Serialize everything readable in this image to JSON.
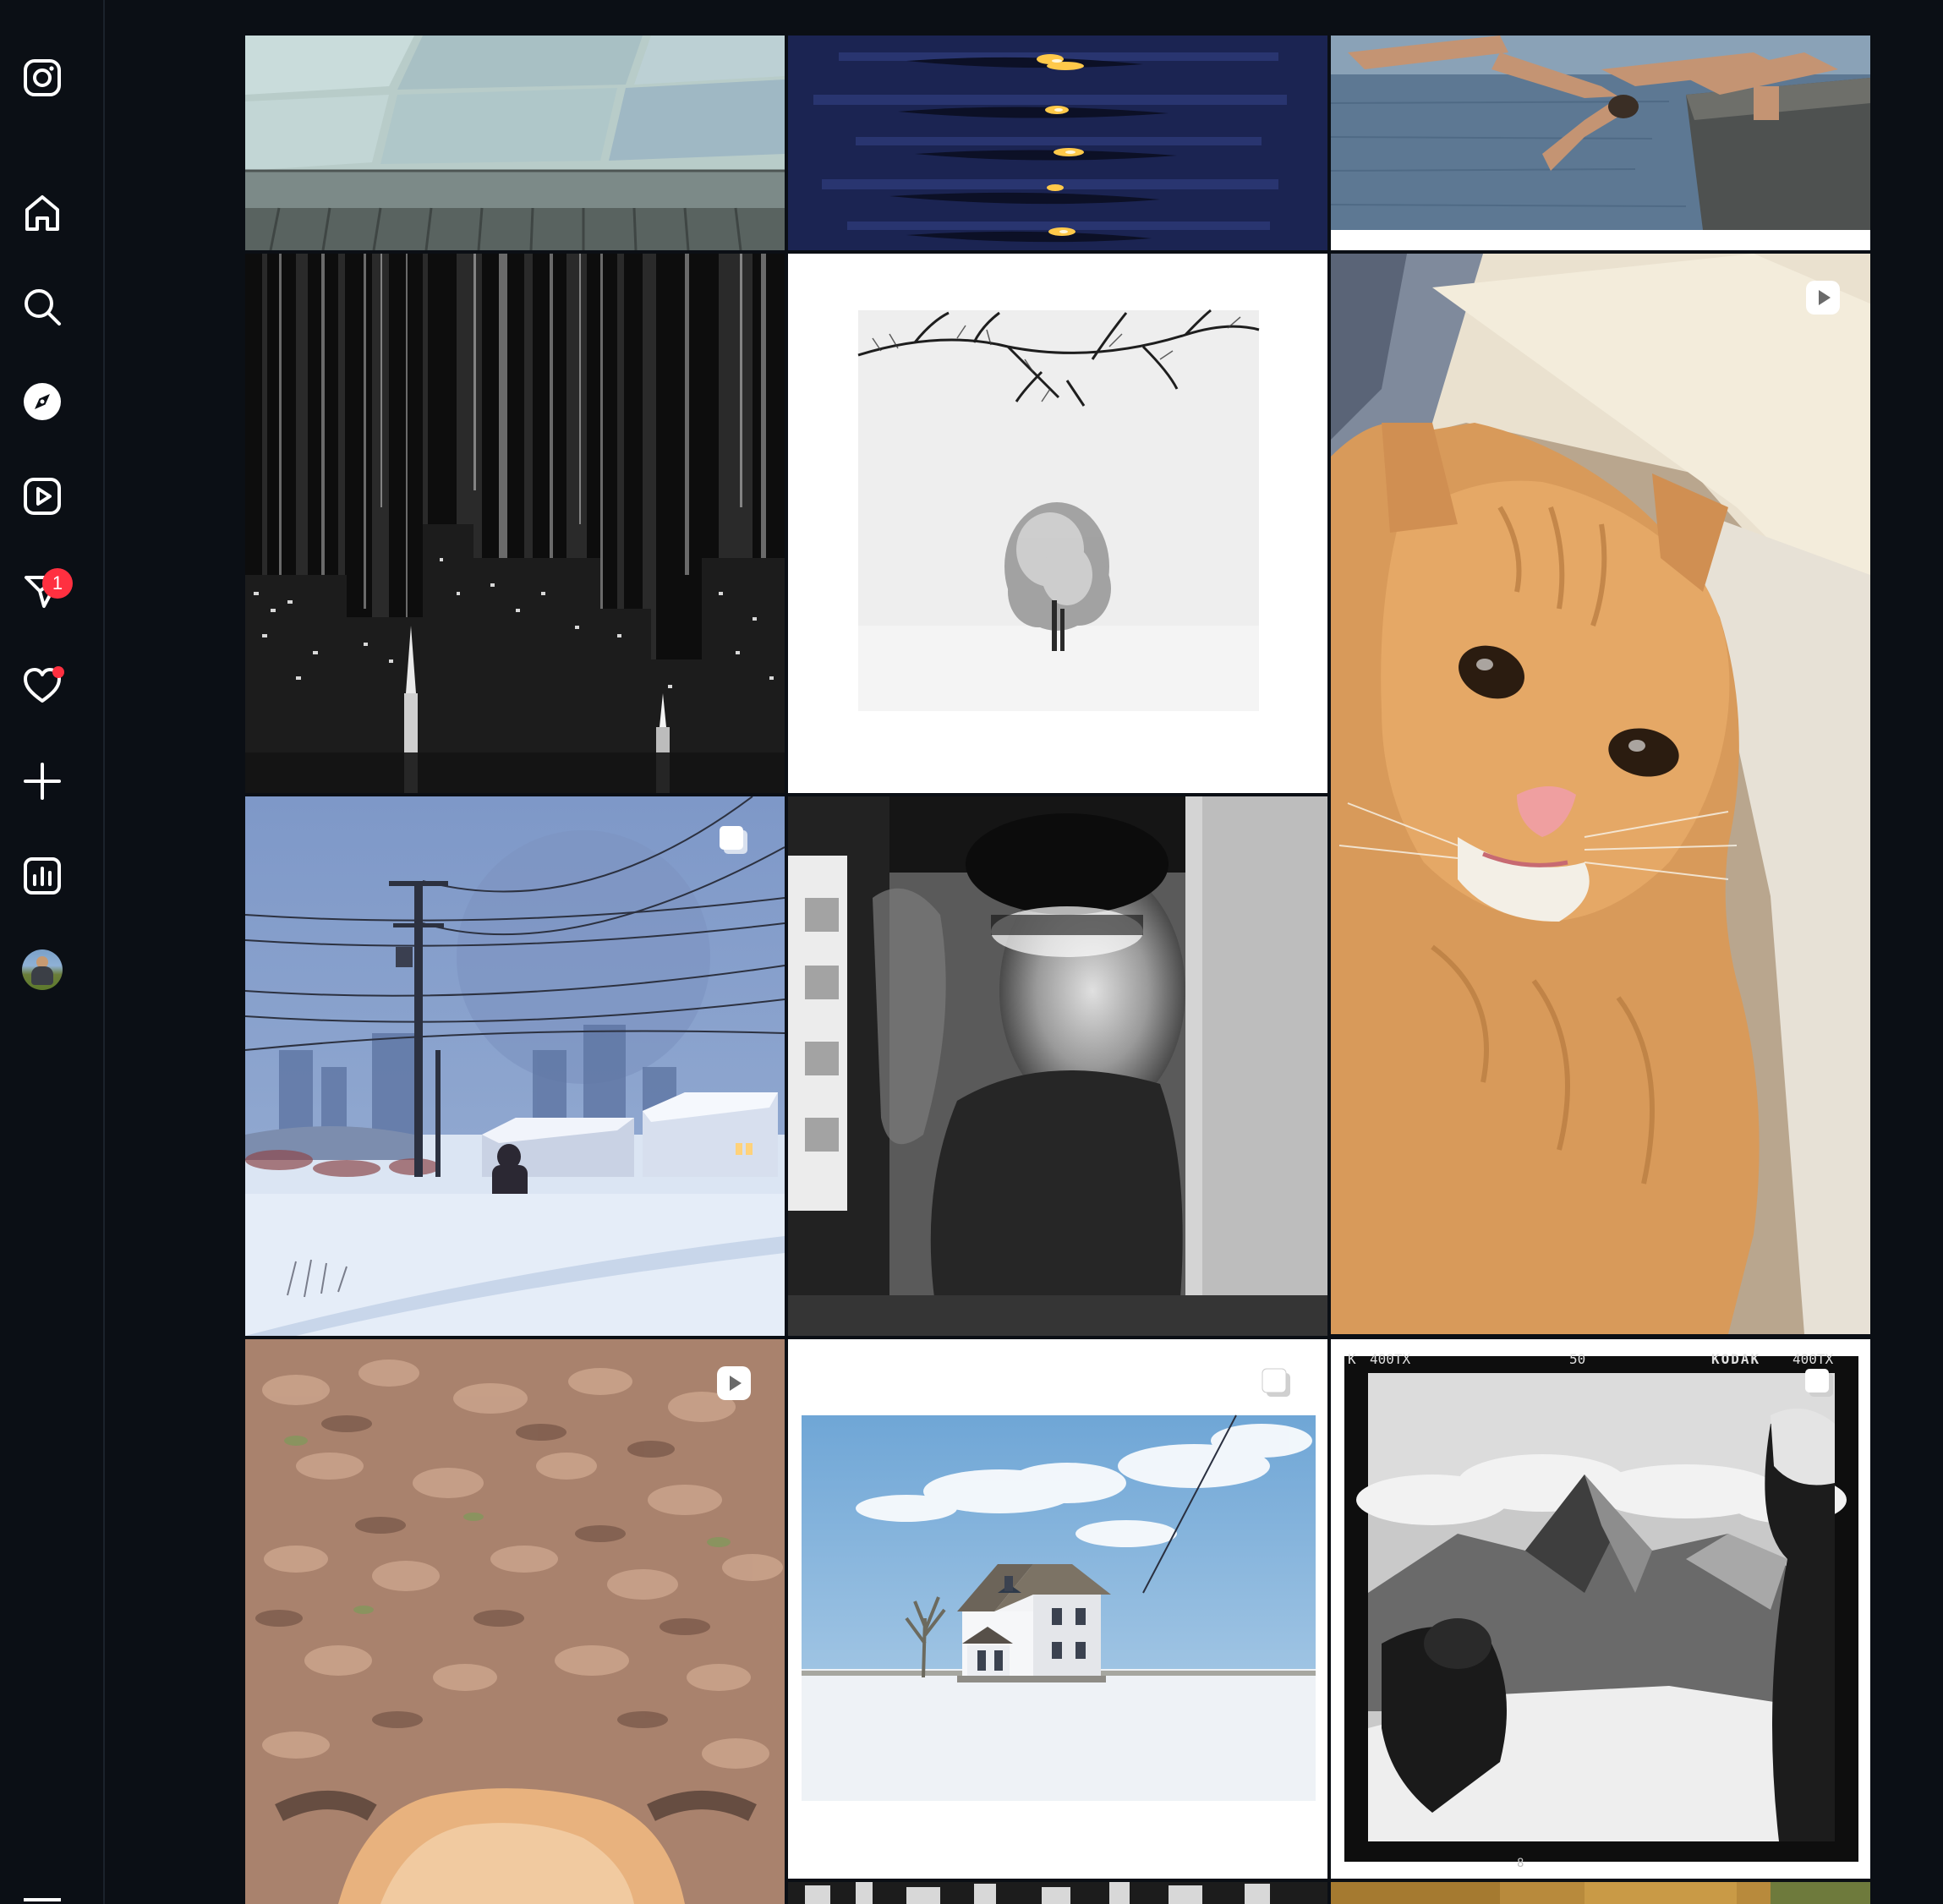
{
  "sidebar": {
    "items": [
      {
        "name": "instagram-logo",
        "icon": "instagram-icon"
      },
      {
        "name": "home",
        "icon": "home-icon"
      },
      {
        "name": "search",
        "icon": "search-icon"
      },
      {
        "name": "explore",
        "icon": "compass-icon"
      },
      {
        "name": "reels",
        "icon": "reels-icon"
      },
      {
        "name": "messages",
        "icon": "messenger-icon",
        "badge": "1"
      },
      {
        "name": "notifications",
        "icon": "heart-icon",
        "dot": true
      },
      {
        "name": "create",
        "icon": "plus-icon"
      },
      {
        "name": "dashboard",
        "icon": "chart-icon"
      },
      {
        "name": "profile",
        "icon": "avatar"
      }
    ],
    "badge_color": "#ff3040"
  },
  "grid": {
    "posts": [
      {
        "id": "sidewalk",
        "type": "image"
      },
      {
        "id": "water-reflections",
        "type": "image"
      },
      {
        "id": "divers",
        "type": "image"
      },
      {
        "id": "city-bw",
        "type": "image"
      },
      {
        "id": "snow-tree",
        "type": "image"
      },
      {
        "id": "cat",
        "type": "reel",
        "badge_icon": "reel-play-icon"
      },
      {
        "id": "winter-power-lines",
        "type": "carousel",
        "badge_icon": "carousel-icon"
      },
      {
        "id": "blurred-portrait",
        "type": "image"
      },
      {
        "id": "fox-leaves",
        "type": "reel",
        "badge_icon": "reel-play-icon"
      },
      {
        "id": "white-house",
        "type": "carousel",
        "badge_icon": "carousel-icon"
      },
      {
        "id": "mountain-film",
        "type": "carousel",
        "badge_icon": "carousel-icon"
      }
    ],
    "film_edge": {
      "top_left": "K",
      "top_code_1": "400TX",
      "top_center": "50",
      "top_brand": "KODAK",
      "top_code_2": "400TX",
      "bottom_frame": "8"
    }
  },
  "colors": {
    "background": "#0b0f15",
    "icon": "#ffffff"
  }
}
